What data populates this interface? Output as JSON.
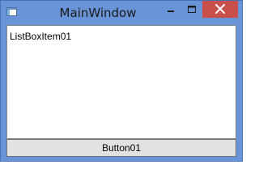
{
  "window": {
    "title": "MainWindow",
    "colors": {
      "frame": "#6a94d8",
      "close_button": "#c7504b"
    }
  },
  "titlebar": {
    "app_icon": "window-icon",
    "minimize_icon": "minimize-icon",
    "maximize_icon": "maximize-icon",
    "close_icon": "close-icon"
  },
  "listbox": {
    "items": [
      {
        "label": "ListBoxItem01"
      }
    ]
  },
  "button": {
    "label": "Button01"
  }
}
